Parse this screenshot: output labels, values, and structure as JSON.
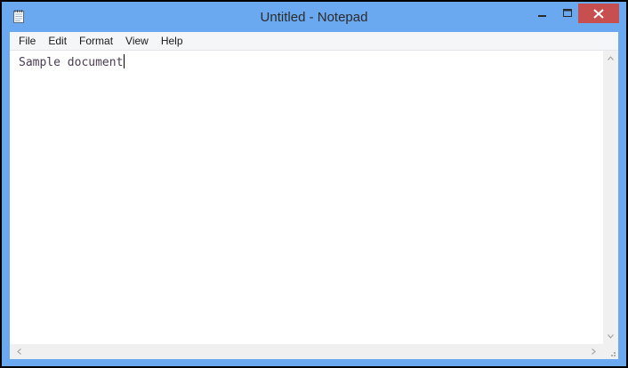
{
  "window": {
    "title": "Untitled - Notepad",
    "icon": "notepad-icon"
  },
  "controls": {
    "minimize_icon": "minimize-icon",
    "maximize_icon": "maximize-icon",
    "close_icon": "close-icon",
    "close_color": "#c74f4f"
  },
  "menu": {
    "items": [
      {
        "label": "File"
      },
      {
        "label": "Edit"
      },
      {
        "label": "Format"
      },
      {
        "label": "View"
      },
      {
        "label": "Help"
      }
    ]
  },
  "editor": {
    "content": "Sample document"
  },
  "colors": {
    "frame": "#6aa9f0",
    "editor_background": "#ffffff",
    "text": "#4a3b54"
  }
}
